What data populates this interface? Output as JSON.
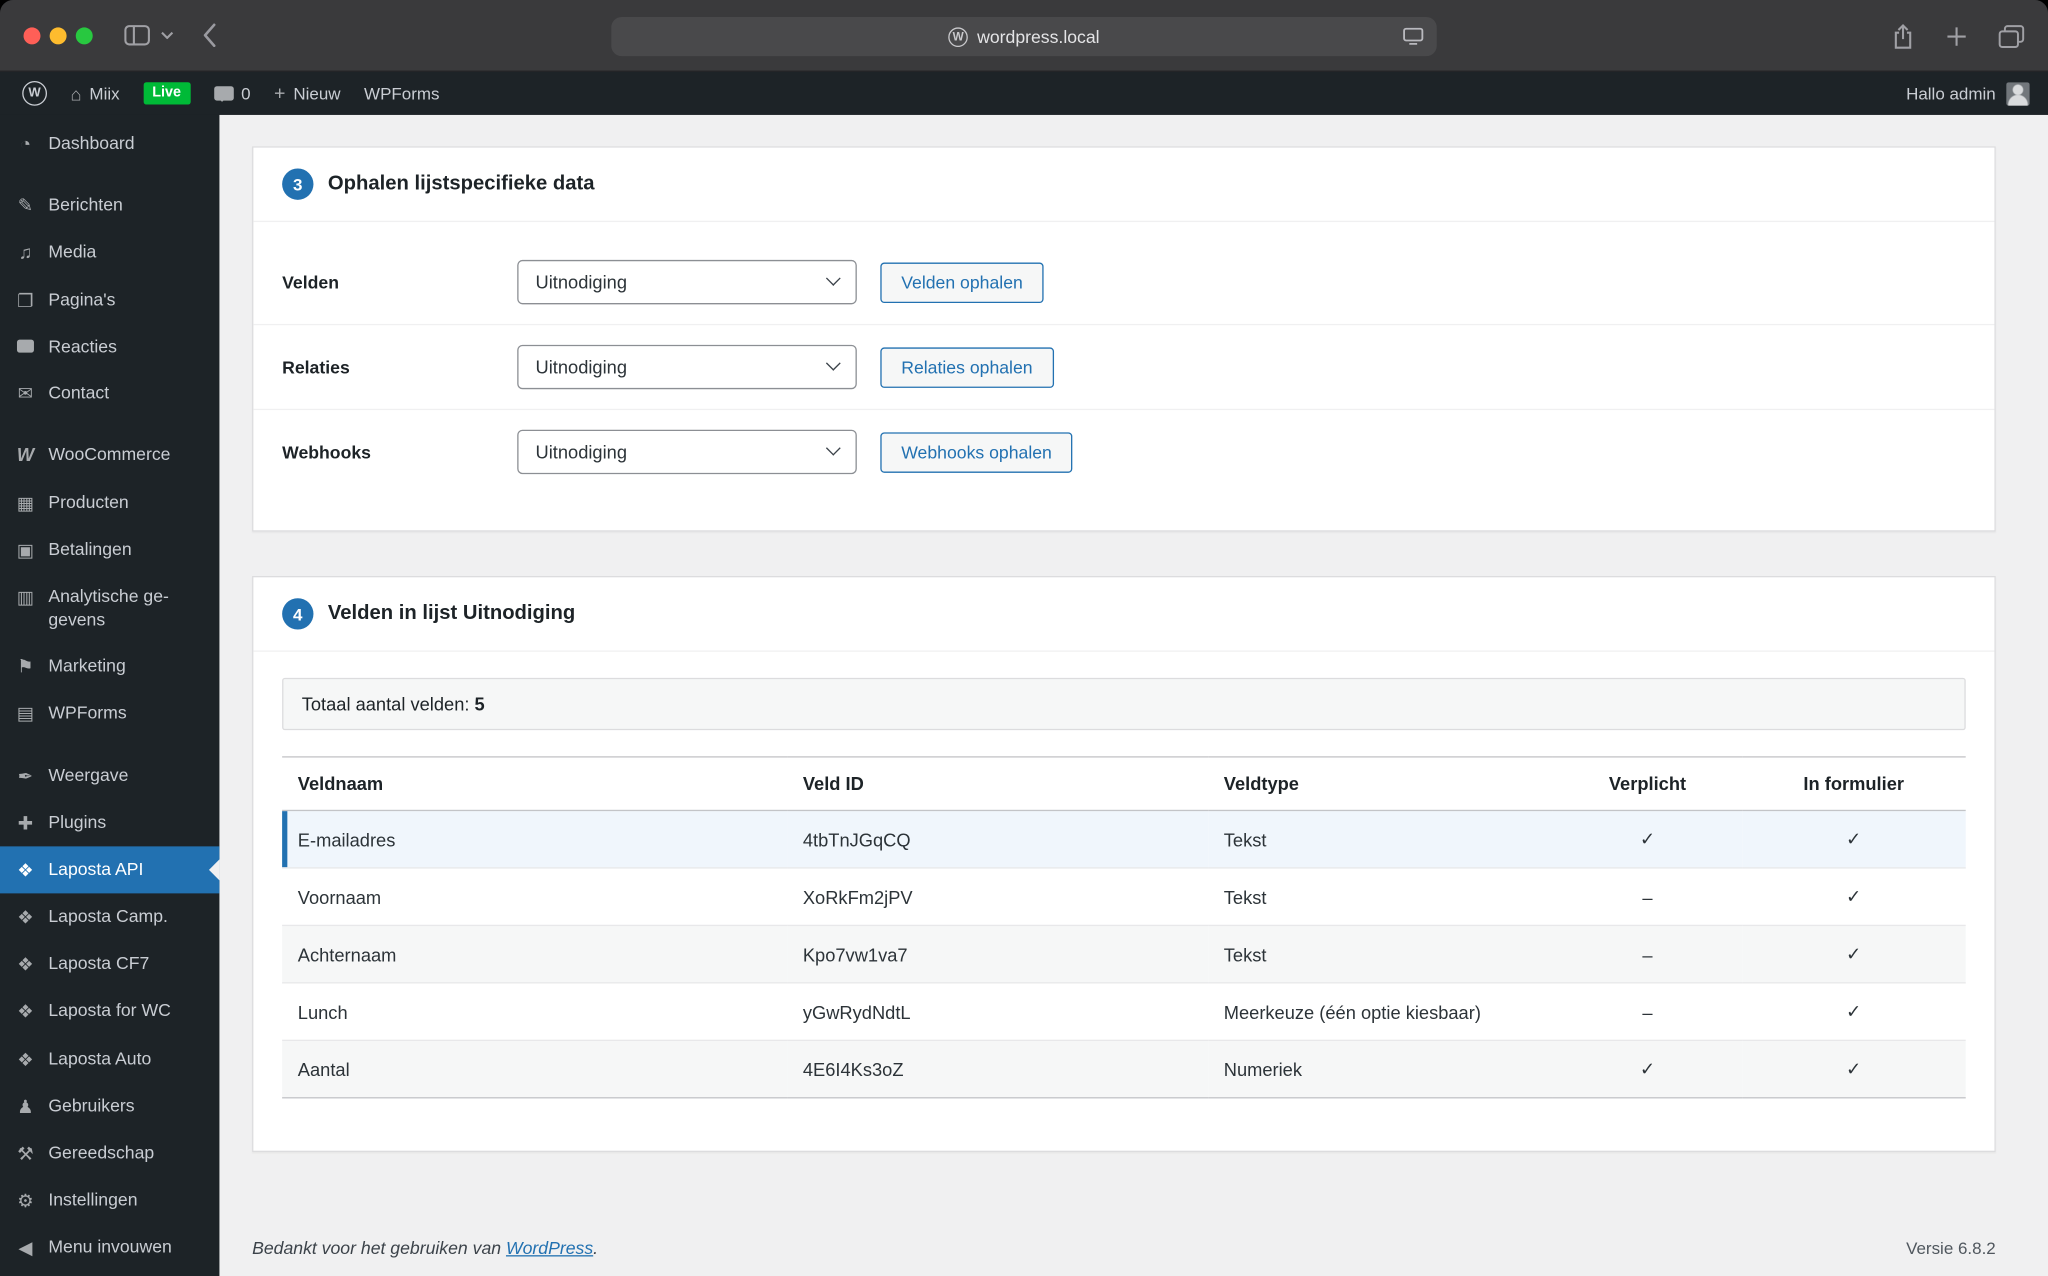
{
  "browser": {
    "url": "wordpress.local"
  },
  "admin_bar": {
    "site_name": "Miix",
    "live_badge": "Live",
    "comment_count": "0",
    "new_label": "Nieuw",
    "wpforms_label": "WPForms",
    "greeting": "Hallo admin"
  },
  "sidebar": {
    "items": [
      {
        "id": "dashboard",
        "label": "Dashboard",
        "glyph": "◔"
      },
      {
        "id": "posts",
        "label": "Berichten",
        "glyph": "✎"
      },
      {
        "id": "media",
        "label": "Media",
        "glyph": "♫"
      },
      {
        "id": "pages",
        "label": "Pagina's",
        "glyph": "❐"
      },
      {
        "id": "comments",
        "label": "Reacties",
        "glyph": ""
      },
      {
        "id": "contact",
        "label": "Contact",
        "glyph": "✉"
      },
      {
        "id": "woocommerce",
        "label": "WooCommerce",
        "glyph": "W"
      },
      {
        "id": "products",
        "label": "Producten",
        "glyph": "▦"
      },
      {
        "id": "payments",
        "label": "Betalingen",
        "glyph": "▣"
      },
      {
        "id": "analytics",
        "label": "Analytische ge-gevens",
        "glyph": "▥"
      },
      {
        "id": "marketing",
        "label": "Marketing",
        "glyph": "⚑"
      },
      {
        "id": "wpforms",
        "label": "WPForms",
        "glyph": "▤"
      },
      {
        "id": "appearance",
        "label": "Weergave",
        "glyph": "✒"
      },
      {
        "id": "plugins",
        "label": "Plugins",
        "glyph": "✚"
      },
      {
        "id": "laposta-api",
        "label": "Laposta API",
        "glyph": "❖"
      },
      {
        "id": "laposta-camp",
        "label": "Laposta Camp.",
        "glyph": "❖"
      },
      {
        "id": "laposta-cf7",
        "label": "Laposta CF7",
        "glyph": "❖"
      },
      {
        "id": "laposta-wc",
        "label": "Laposta for WC",
        "glyph": "❖"
      },
      {
        "id": "laposta-auto",
        "label": "Laposta Auto",
        "glyph": "❖"
      },
      {
        "id": "users",
        "label": "Gebruikers",
        "glyph": "♟"
      },
      {
        "id": "tools",
        "label": "Gereedschap",
        "glyph": "⚒"
      },
      {
        "id": "settings",
        "label": "Instellingen",
        "glyph": "⚙"
      }
    ],
    "collapse": {
      "label": "Menu invouwen",
      "glyph": "◀"
    }
  },
  "content": {
    "step3": {
      "step_number": "3",
      "title": "Ophalen lijstspecifieke data",
      "rows": [
        {
          "label": "Velden",
          "select_value": "Uitnodiging",
          "button": "Velden ophalen"
        },
        {
          "label": "Relaties",
          "select_value": "Uitnodiging",
          "button": "Relaties ophalen"
        },
        {
          "label": "Webhooks",
          "select_value": "Uitnodiging",
          "button": "Webhooks ophalen"
        }
      ]
    },
    "step4": {
      "step_number": "4",
      "title": "Velden in lijst Uitnodiging",
      "total_label": "Totaal aantal velden:",
      "total_value": "5",
      "table": {
        "headers": [
          "Veldnaam",
          "Veld ID",
          "Veldtype",
          "Verplicht",
          "In formulier"
        ],
        "rows": [
          [
            "E-mailadres",
            "4tbTnJGqCQ",
            "Tekst",
            "✓",
            "✓"
          ],
          [
            "Voornaam",
            "XoRkFm2jPV",
            "Tekst",
            "–",
            "✓"
          ],
          [
            "Achternaam",
            "Kpo7vw1va7",
            "Tekst",
            "–",
            "✓"
          ],
          [
            "Lunch",
            "yGwRydNdtL",
            "Meerkeuze (één optie kiesbaar)",
            "–",
            "✓"
          ],
          [
            "Aantal",
            "4E6I4Ks3oZ",
            "Numeriek",
            "✓",
            "✓"
          ]
        ]
      }
    },
    "footer": {
      "thanks_prefix": "Bedankt voor het gebruiken van ",
      "thanks_link": "WordPress",
      "thanks_suffix": ".",
      "version": "Versie 6.8.2"
    }
  },
  "colors": {
    "accent_blue": "#2271b1",
    "admin_dark": "#1d2327",
    "content_bg": "#f0f0f1",
    "live_green": "#00ba37",
    "row_highlight": "#f0f6fc",
    "traffic_red": "#ff5f57",
    "traffic_yellow": "#febc2e",
    "traffic_green": "#28c840"
  }
}
